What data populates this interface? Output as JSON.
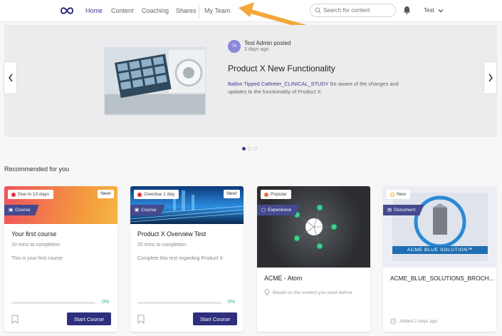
{
  "nav": {
    "items": [
      "Home",
      "Content",
      "Coaching",
      "Shares",
      "My Team"
    ],
    "active": "Home",
    "search_placeholder": "Search for content",
    "user_label": "Test"
  },
  "hero": {
    "avatar_initials": "TA",
    "poster": "Test Admin posted",
    "posted_ago": "3 days ago",
    "title": "Product X New Functionality",
    "link_text": "Ballon Tipped Catheter_CLINICAL_STUDY",
    "body_text": " Be aware of the changes and updates to the functionality of Product X.",
    "slide_count": 3,
    "active_slide": 1
  },
  "section_title": "Recommended for you",
  "cards": [
    {
      "status": "Due in 13 days",
      "new_tag": "New!",
      "type": "Course",
      "title": "Your first course",
      "meta": "10 mins to completion",
      "description": "This is your first course",
      "progress": "0%",
      "button": "Start Course"
    },
    {
      "status": "Overdue 1 day",
      "new_tag": "New!",
      "type": "Course",
      "title": "Product X Overview Test",
      "meta": "25 mins to completion",
      "description": "Complete this test regarding Product X",
      "progress": "0%",
      "button": "Start Course"
    },
    {
      "status": "Popular",
      "type": "Experience",
      "title": "ACME - Atom",
      "footer": "Based on the content you used before"
    },
    {
      "status": "New",
      "type": "Document",
      "title": "ACME_BLUE_SOLUTIONS_BROCH...",
      "image_text": "ACME BLUE SOLUTION™",
      "footer": "Added 2 days ago"
    }
  ],
  "colors": {
    "accent": "#2e2f7e",
    "annotation_arrow": "#f2a93b",
    "progress_text": "#2fb38a"
  }
}
